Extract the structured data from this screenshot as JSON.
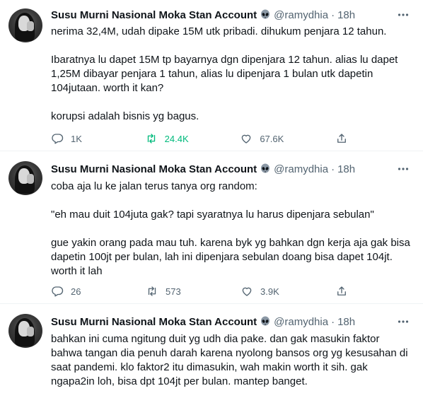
{
  "colors": {
    "text": "#0f1419",
    "secondary": "#536471",
    "retweet_active": "#00ba7c",
    "divider": "#eff3f4"
  },
  "tweets": [
    {
      "author_name": "Susu Murni Nasional Moka Stan Account",
      "badge_icon": "alien-emoji-icon",
      "handle": "@ramydhia",
      "dot": "·",
      "time": "18h",
      "paragraphs": [
        "nerima 32,4M, udah dipake 15M utk pribadi. dihukum penjara 12 tahun.",
        "Ibaratnya lu dapet 15M tp bayarnya dgn dipenjara 12 tahun. alias lu dapet\n1,25M dibayar penjara 1 tahun, alias lu dipenjara 1 bulan utk dapetin\n104jutaan. worth it kan?",
        "korupsi adalah bisnis yg bagus."
      ],
      "replies": "1K",
      "retweets": "24.4K",
      "retweeted": true,
      "likes": "67.6K"
    },
    {
      "author_name": "Susu Murni Nasional Moka Stan Account",
      "badge_icon": "alien-emoji-icon",
      "handle": "@ramydhia",
      "dot": "·",
      "time": "18h",
      "paragraphs": [
        "coba aja lu ke jalan terus tanya org random:",
        "\"eh mau duit 104juta gak? tapi syaratnya lu harus dipenjara sebulan\"",
        "gue yakin orang pada mau tuh. karena byk yg bahkan dgn kerja aja gak bisa\ndapetin 100jt per bulan, lah ini dipenjara sebulan doang bisa dapet 104jt.\nworth it lah"
      ],
      "replies": "26",
      "retweets": "573",
      "retweeted": false,
      "likes": "3.9K"
    },
    {
      "author_name": "Susu Murni Nasional Moka Stan Account",
      "badge_icon": "alien-emoji-icon",
      "handle": "@ramydhia",
      "dot": "·",
      "time": "18h",
      "paragraphs": [
        "bahkan ini cuma ngitung duit yg udh dia pake. dan gak masukin faktor\nbahwa tangan dia penuh darah karena nyolong bansos org yg kesusahan di\nsaat pandemi. klo faktor2 itu dimasukin, wah makin worth it sih. gak\nngapa2in loh, bisa dpt 104jt per bulan. mantep banget."
      ]
    }
  ]
}
